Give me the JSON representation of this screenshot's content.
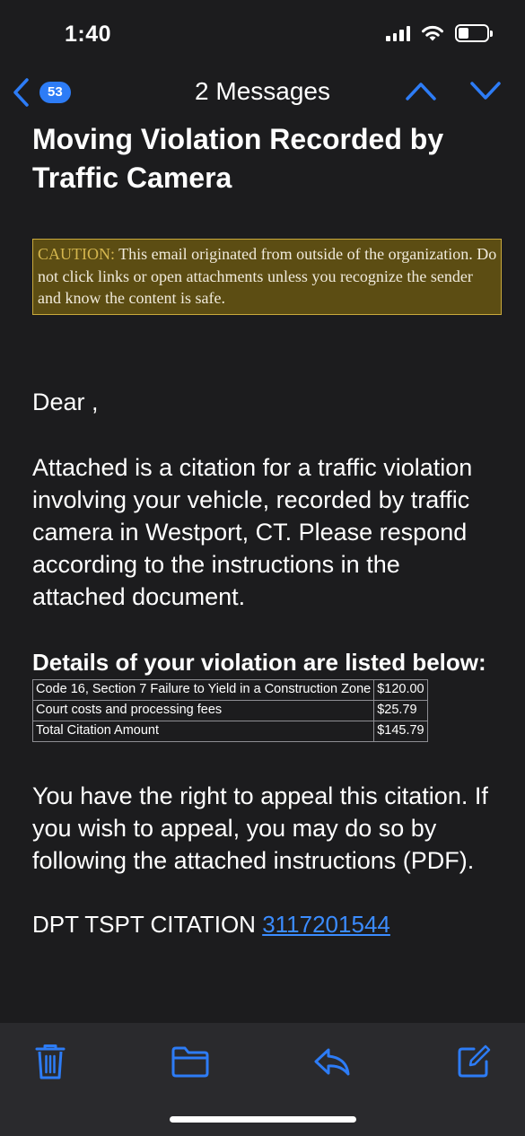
{
  "status_bar": {
    "time": "1:40",
    "battery_level": 0.35
  },
  "nav": {
    "back_count": "53",
    "title": "2 Messages",
    "icons": [
      "chevron-left-icon",
      "chevron-up-icon",
      "chevron-down-icon"
    ]
  },
  "email": {
    "subject": "Moving Violation Recorded by Traffic Camera",
    "caution_label": "CAUTION:",
    "caution_text": " This email originated from outside of the organization. Do not click links or open attachments unless you recognize the sender and know the content is safe.",
    "greeting": "Dear ,",
    "body": "Attached is a citation for a traffic violation involving your vehicle, recorded by traffic camera in Westport, CT. Please respond according to the instructions in the attached document.",
    "details_heading": "Details of your violation are listed below:",
    "violations": [
      {
        "description": "Code 16, Section 7 Failure to Yield in a Construction Zone",
        "amount": "$120.00"
      },
      {
        "description": "Court costs and processing fees",
        "amount": "$25.79"
      },
      {
        "description": "Total Citation Amount",
        "amount": "$145.79"
      }
    ],
    "appeal": "You have the right to appeal this citation. If you wish to appeal, you may do so by following the attached instructions (PDF).",
    "citation_label": "DPT TSPT CITATION ",
    "citation_number": "3117201544"
  },
  "toolbar": {
    "icons": [
      "trash-icon",
      "folder-icon",
      "reply-icon",
      "compose-icon"
    ]
  },
  "colors": {
    "accent": "#2d7cf6",
    "link": "#3b8cff",
    "background": "#1c1c1e",
    "caution_bg": "#5c4d13",
    "caution_border": "#c9a93c"
  }
}
